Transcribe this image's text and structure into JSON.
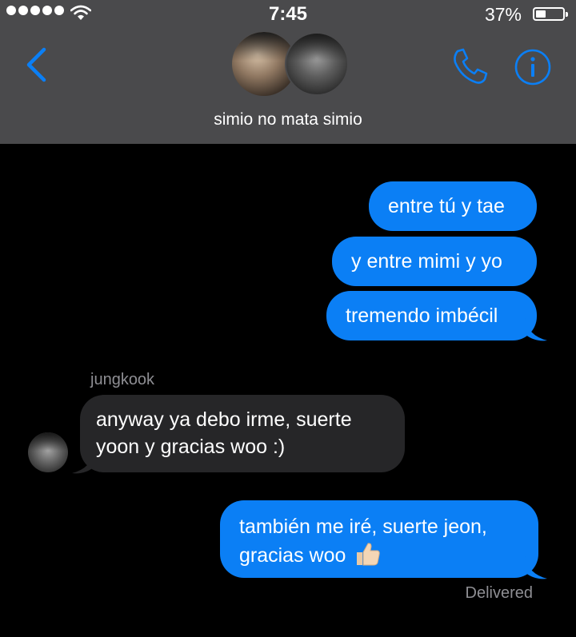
{
  "status_bar": {
    "time": "7:45",
    "battery": "37%"
  },
  "header": {
    "group_name": "simio no mata simio",
    "accent_color": "#0b7ff5",
    "icons": [
      "chevron-left-icon",
      "phone-icon",
      "info-icon"
    ]
  },
  "messages": [
    {
      "direction": "outgoing",
      "text": "entre tú y tae"
    },
    {
      "direction": "outgoing",
      "text": "y entre mimi y yo"
    },
    {
      "direction": "outgoing",
      "text": "tremendo imbécil"
    },
    {
      "direction": "incoming",
      "sender": "jungkook",
      "lines": [
        "anyway ya debo irme, suerte",
        "yoon y gracias woo :)"
      ]
    },
    {
      "direction": "outgoing",
      "lines": [
        "también me iré, suerte jeon,",
        "gracias woo"
      ],
      "emoji": "👍🏻"
    }
  ],
  "delivery_status": "Delivered"
}
